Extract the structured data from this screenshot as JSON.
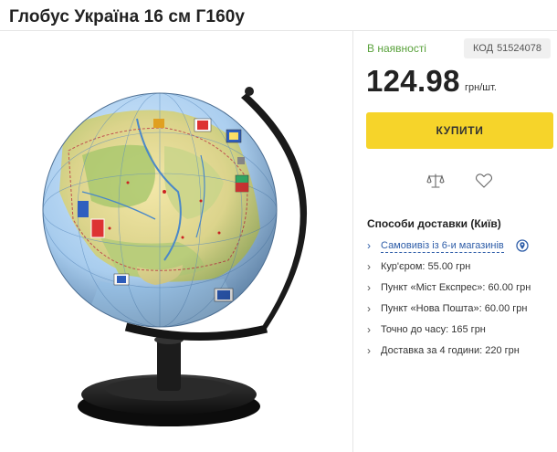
{
  "product": {
    "title": "Глобус Україна 16 см Г160у"
  },
  "stock": {
    "label": "В наявності"
  },
  "code": {
    "label": "КОД",
    "value": "51524078"
  },
  "price": {
    "value": "124.98",
    "unit": "грн/шт."
  },
  "buy_button": {
    "label": "КУПИТИ",
    "color": "#f6d42a"
  },
  "actions": {
    "compare_icon": "scales-icon",
    "wishlist_icon": "heart-icon"
  },
  "delivery": {
    "title": "Способи доставки (Київ)",
    "items": [
      {
        "label": "Самовивіз із 6-и магазинів",
        "icon": "map-pin-icon",
        "link": true
      },
      {
        "label": "Кур'єром: 55.00 грн"
      },
      {
        "label": "Пункт «Міст Експрес»: 60.00 грн"
      },
      {
        "label": "Пункт «Нова Пошта»: 60.00 грн"
      },
      {
        "label": "Точно до часу: 165 грн"
      },
      {
        "label": "Доставка за 4 години: 220 грн"
      }
    ]
  },
  "colors": {
    "accent_green": "#5aa23c",
    "link_blue": "#2e5da8"
  }
}
